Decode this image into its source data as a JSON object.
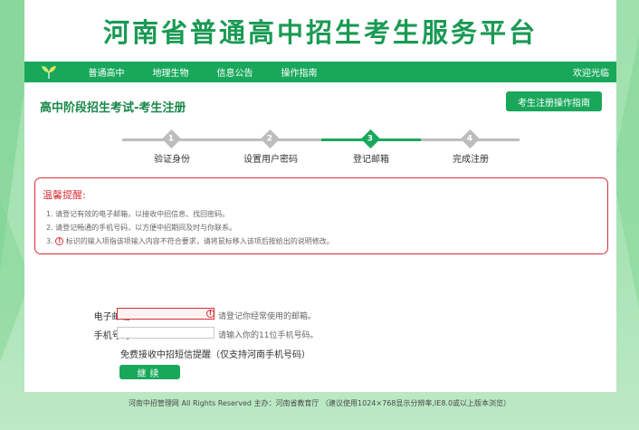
{
  "banner": {
    "title": "河南省普通高中招生考生服务平台"
  },
  "nav": {
    "logo_icon": "leaf-logo-icon",
    "items": [
      {
        "label": "普通高中"
      },
      {
        "label": "地理生物"
      },
      {
        "label": "信息公告"
      },
      {
        "label": "操作指南"
      }
    ],
    "welcome": "欢迎光临"
  },
  "page": {
    "title": "高中阶段招生考试-考生注册",
    "guide_button": "考生注册操作指南"
  },
  "steps": [
    {
      "num": "1",
      "label": "验证身份",
      "active": false
    },
    {
      "num": "2",
      "label": "设置用户密码",
      "active": false
    },
    {
      "num": "3",
      "label": "登记邮箱",
      "active": true
    },
    {
      "num": "4",
      "label": "完成注册",
      "active": false
    }
  ],
  "notice": {
    "title": "温馨提醒:",
    "lines": [
      "1. 请登记有效的电子邮箱，以接收中招信息、找回密码。",
      "2. 请登记畅通的手机号码，以方便中招期间及时与你联系。",
      "3.",
      "标识的输入项指该项输入内容不符合要求，请将鼠标移入该项后按给出的说明修改。"
    ]
  },
  "form": {
    "email": {
      "label": "电子邮箱:",
      "value": "",
      "hint": "请登记你经常使用的邮箱。"
    },
    "phone": {
      "label": "手机号码:",
      "value": "",
      "hint": "请输入你的11位手机号码。"
    },
    "sms_text": "免费接收中招短信提醒（仅支持河南手机号码）",
    "continue": "继续"
  },
  "footer": "河南中招管理网 All Rights Reserved 主办：河南省教育厅 （建议使用1024×768显示分辨率,IE8.0或以上版本浏览）",
  "colors": {
    "brand": "#19a85b",
    "title": "#1a9a54",
    "alert": "#d9303a"
  }
}
